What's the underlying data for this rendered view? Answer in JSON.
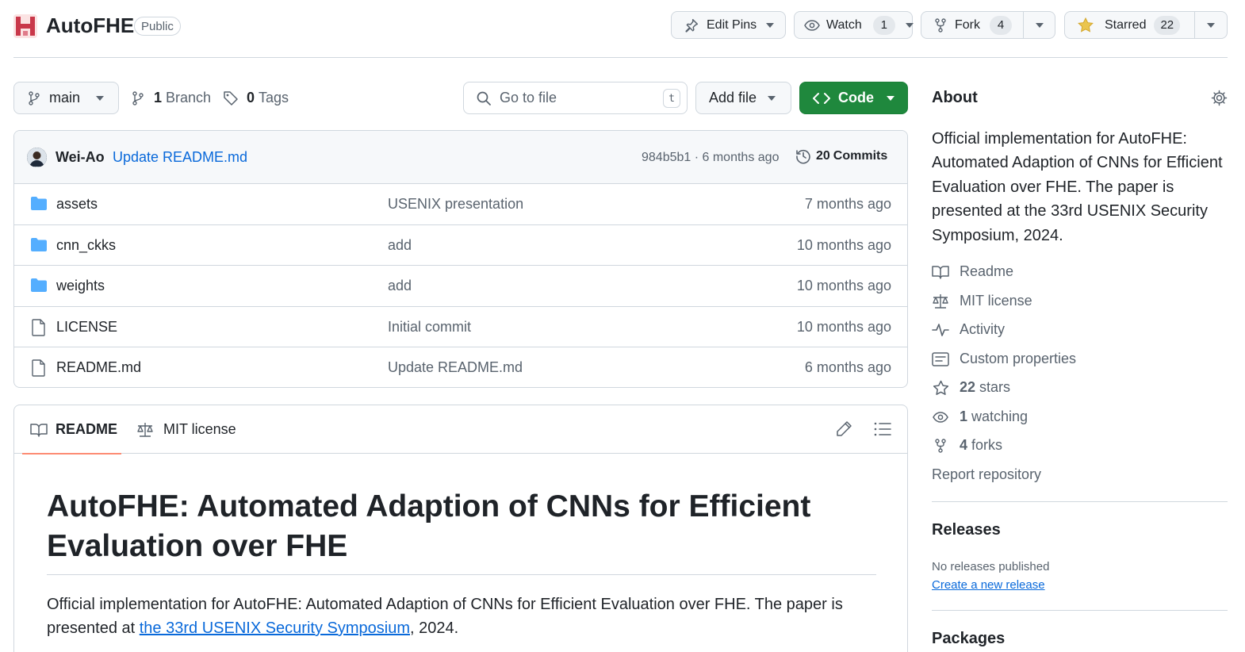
{
  "repo": {
    "name": "AutoFHE",
    "visibility": "Public"
  },
  "actions": {
    "edit_pins": "Edit Pins",
    "watch": "Watch",
    "watch_count": "1",
    "fork": "Fork",
    "fork_count": "4",
    "starred": "Starred",
    "star_count": "22"
  },
  "toolbar": {
    "branch": "main",
    "branches_count": "1",
    "branches_label": "Branch",
    "tags_count": "0",
    "tags_label": "Tags",
    "search_placeholder": "Go to file",
    "search_shortcut": "t",
    "add_file": "Add file",
    "code": "Code"
  },
  "commit": {
    "author": "Wei-Ao",
    "message": "Update README.md",
    "hash_time": "984b5b1 · 6 months ago",
    "commits_count": "20",
    "commits_label": "Commits"
  },
  "files": [
    {
      "type": "folder",
      "name": "assets",
      "message": "USENIX presentation",
      "date": "7 months ago"
    },
    {
      "type": "folder",
      "name": "cnn_ckks",
      "message": "add",
      "date": "10 months ago"
    },
    {
      "type": "folder",
      "name": "weights",
      "message": "add",
      "date": "10 months ago"
    },
    {
      "type": "file",
      "name": "LICENSE",
      "message": "Initial commit",
      "date": "10 months ago"
    },
    {
      "type": "file",
      "name": "README.md",
      "message": "Update README.md",
      "date": "6 months ago"
    }
  ],
  "readme": {
    "tab_readme": "README",
    "tab_license": "MIT license",
    "title": "AutoFHE: Automated Adaption of CNNs for Efficient Evaluation over FHE",
    "paragraph_before": "Official implementation for AutoFHE: Automated Adaption of CNNs for Efficient Evaluation over FHE. The paper is presented at ",
    "link_text": "the 33rd USENIX Security Symposium",
    "paragraph_after": ", 2024."
  },
  "about": {
    "heading": "About",
    "description": "Official implementation for AutoFHE: Automated Adaption of CNNs for Efficient Evaluation over FHE. The paper is presented at the 33rd USENIX Security Symposium, 2024.",
    "readme": "Readme",
    "license": "MIT license",
    "activity": "Activity",
    "custom_properties": "Custom properties",
    "stars_count": "22",
    "stars_label": "stars",
    "watching_count": "1",
    "watching_label": "watching",
    "forks_count": "4",
    "forks_label": "forks",
    "report": "Report repository"
  },
  "releases": {
    "heading": "Releases",
    "none": "No releases published",
    "create": "Create a new release"
  },
  "packages": {
    "heading": "Packages"
  },
  "colors": {
    "accent_green": "#1f883d",
    "link_blue": "#0969da",
    "star_yellow": "#eac54f",
    "folder_blue": "#54aeff"
  }
}
